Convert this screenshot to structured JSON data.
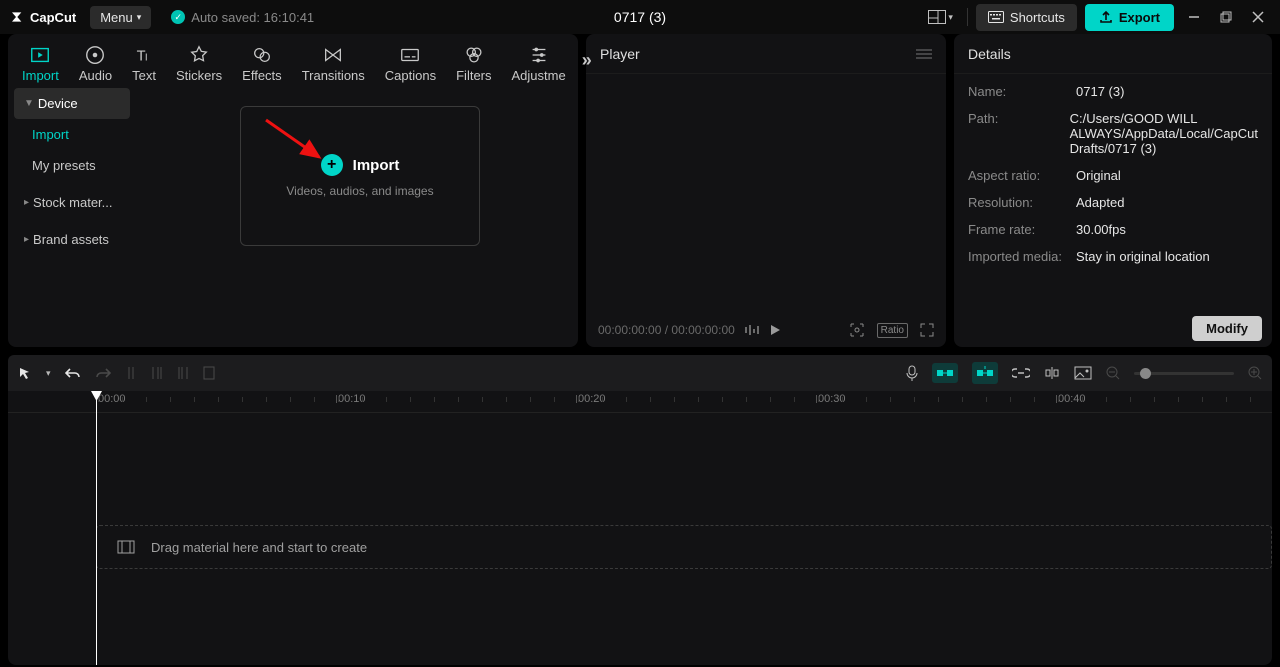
{
  "app": {
    "name": "CapCut"
  },
  "titlebar": {
    "menu_label": "Menu",
    "autosave_label": "Auto saved: 16:10:41",
    "project_title": "0717 (3)",
    "shortcuts_label": "Shortcuts",
    "export_label": "Export"
  },
  "tabs": {
    "import": "Import",
    "audio": "Audio",
    "text": "Text",
    "stickers": "Stickers",
    "effects": "Effects",
    "transitions": "Transitions",
    "captions": "Captions",
    "filters": "Filters",
    "adjustment": "Adjustme"
  },
  "sidebar": {
    "device": "Device",
    "import": "Import",
    "my_presets": "My presets",
    "stock": "Stock mater...",
    "brand": "Brand assets"
  },
  "import_box": {
    "label": "Import",
    "sub": "Videos, audios, and images"
  },
  "player": {
    "title": "Player",
    "time": "00:00:00:00 / 00:00:00:00",
    "ratio": "Ratio"
  },
  "details": {
    "title": "Details",
    "name_label": "Name:",
    "name_value": "0717 (3)",
    "path_label": "Path:",
    "path_value": "C:/Users/GOOD WILL ALWAYS/AppData/Local/CapCut Drafts/0717 (3)",
    "aspect_label": "Aspect ratio:",
    "aspect_value": "Original",
    "resolution_label": "Resolution:",
    "resolution_value": "Adapted",
    "framerate_label": "Frame rate:",
    "framerate_value": "30.00fps",
    "imported_label": "Imported media:",
    "imported_value": "Stay in original location",
    "modify_label": "Modify"
  },
  "timeline": {
    "ticks": [
      "00:00",
      "00:10",
      "00:20",
      "00:30",
      "00:40"
    ],
    "drop_hint": "Drag material here and start to create"
  }
}
